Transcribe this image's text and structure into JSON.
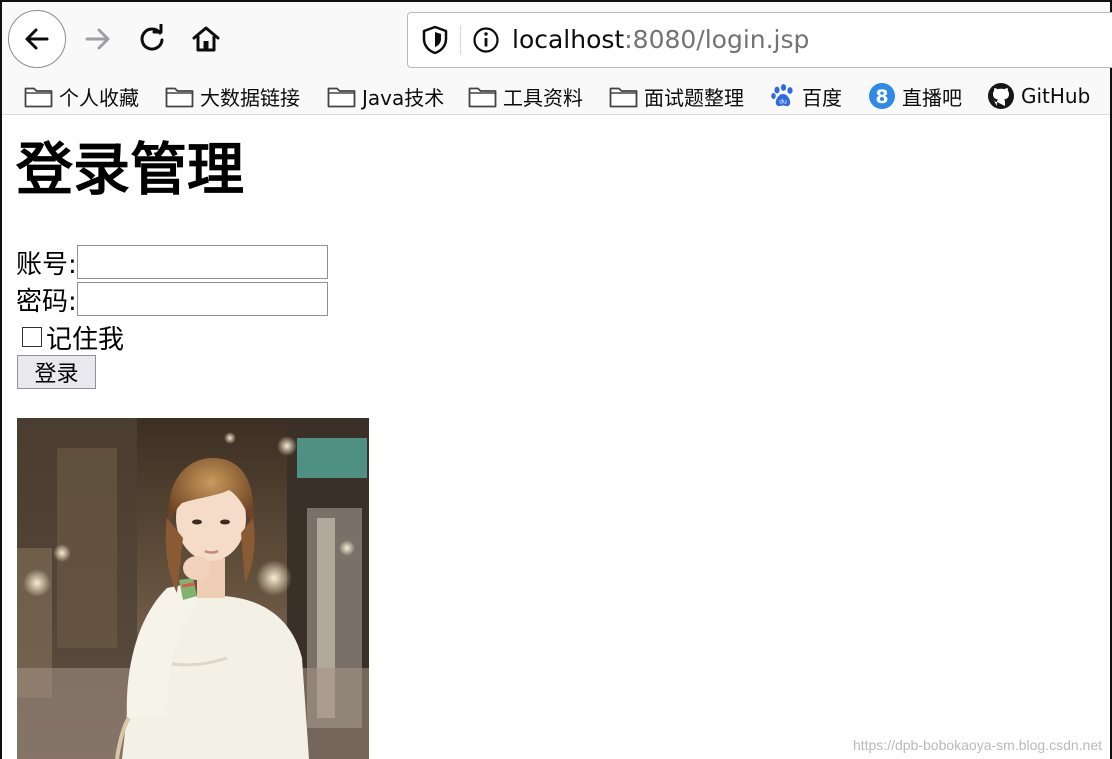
{
  "browser": {
    "url_host": "localhost",
    "url_rest": ":8080/login.jsp"
  },
  "bookmarks": [
    {
      "label": "个人收藏",
      "icon": "folder-icon"
    },
    {
      "label": "大数据链接",
      "icon": "folder-icon"
    },
    {
      "label": "Java技术",
      "icon": "folder-icon"
    },
    {
      "label": "工具资料",
      "icon": "folder-icon"
    },
    {
      "label": "面试题整理",
      "icon": "folder-icon"
    },
    {
      "label": "百度",
      "icon": "baidu-paw-icon"
    },
    {
      "label": "直播吧",
      "icon": "zhibo8-icon"
    },
    {
      "label": "GitHub",
      "icon": "github-icon"
    }
  ],
  "page": {
    "title": "登录管理",
    "account_label": "账号:",
    "account_value": "",
    "password_label": "密码:",
    "password_value": "",
    "remember_label": "记住我",
    "remember_checked": false,
    "login_button": "登录"
  },
  "watermark": "https://dpb-bobokaoya-sm.blog.csdn.net",
  "colors": {
    "chrome_bg": "#f9f9fa",
    "url_host": "#0c0c0d",
    "url_rest": "#737373",
    "button_bg": "#e9e9ed"
  }
}
